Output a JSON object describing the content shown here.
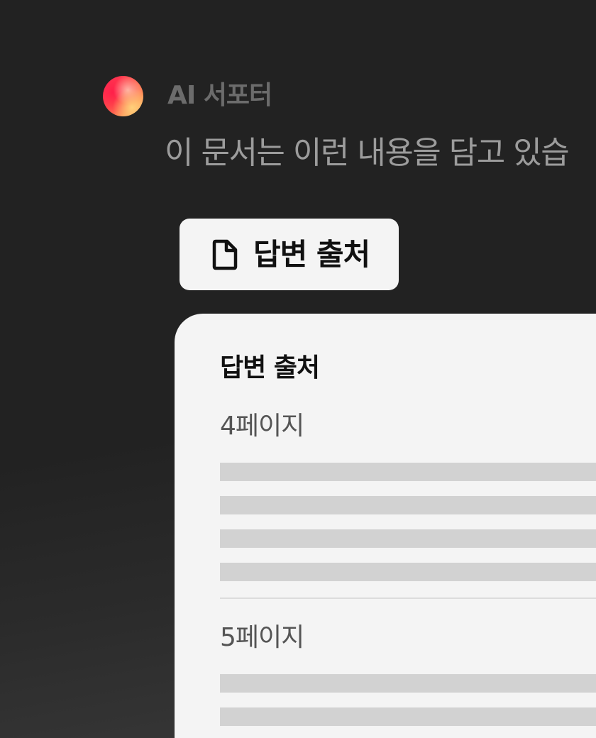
{
  "assistant": {
    "name": "AI 서포터",
    "message": "이 문서는 이런 내용을 담고 있습"
  },
  "source_button": {
    "icon": "document-icon",
    "label": "답변 출처"
  },
  "source_panel": {
    "title": "답변 출처",
    "pages": [
      {
        "label": "4페이지"
      },
      {
        "label": "5페이지"
      }
    ]
  },
  "colors": {
    "background": "#222222",
    "panel": "#f4f4f4",
    "skeleton": "#d2d2d2",
    "avatar_red": "#ff2f5a",
    "avatar_orange": "#ffc46a"
  }
}
